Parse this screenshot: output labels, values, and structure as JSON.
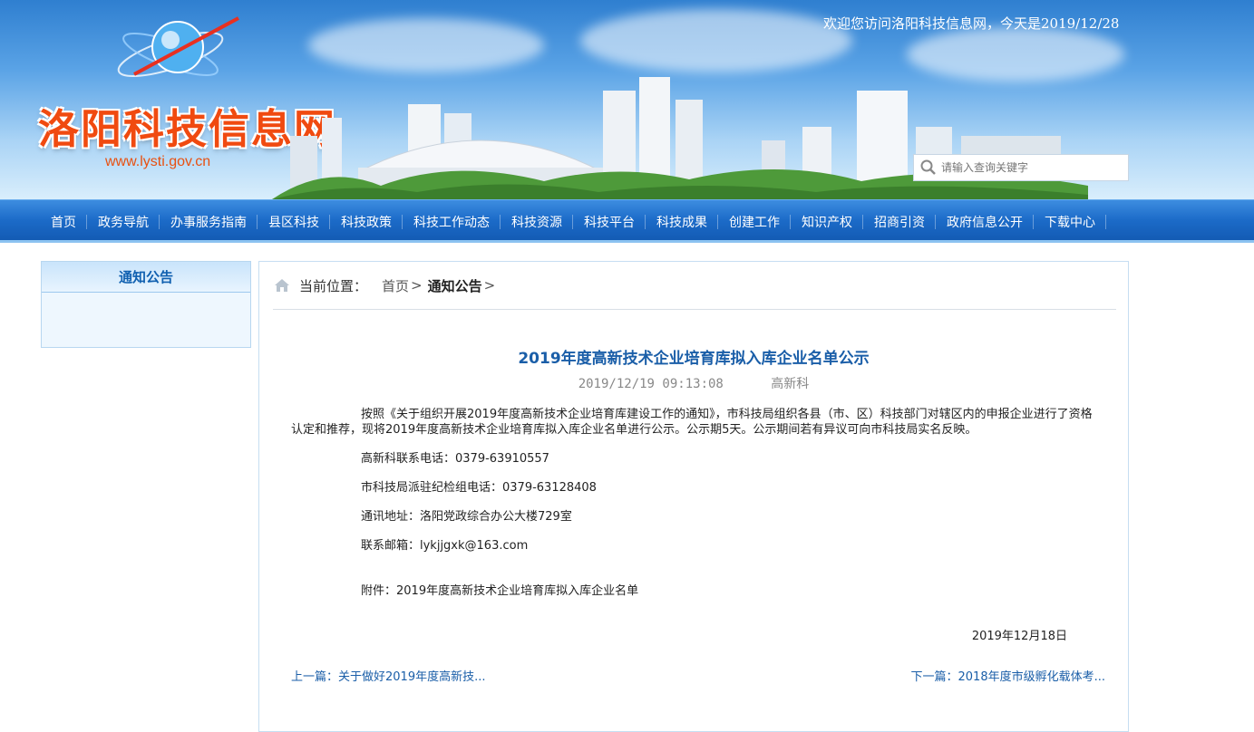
{
  "header": {
    "welcome_text": "欢迎您访问洛阳科技信息网，今天是2019/12/28",
    "site_name": "洛阳科技信息网",
    "site_url": "www.lysti.gov.cn",
    "search_placeholder": "请输入查询关键字"
  },
  "nav": {
    "items": [
      "首页",
      "政务导航",
      "办事服务指南",
      "县区科技",
      "科技政策",
      "科技工作动态",
      "科技资源",
      "科技平台",
      "科技成果",
      "创建工作",
      "知识产权",
      "招商引资",
      "政府信息公开",
      "下载中心"
    ]
  },
  "sidebar": {
    "title": "通知公告"
  },
  "breadcrumb": {
    "label": "当前位置：",
    "home": "首页",
    "current": "通知公告",
    "separator": ">"
  },
  "article": {
    "title": "2019年度高新技术企业培育库拟入库企业名单公示",
    "datetime": "2019/12/19 09:13:08",
    "department": "高新科",
    "paragraph": "按照《关于组织开展2019年度高新技术企业培育库建设工作的通知》，市科技局组织各县（市、区）科技部门对辖区内的申报企业进行了资格认定和推荐，现将2019年度高新技术企业培育库拟入库企业名单进行公示。公示期5天。公示期间若有异议可向市科技局实名反映。",
    "phone_hitech": "高新科联系电话：0379-63910557",
    "phone_discipline": "市科技局派驻纪检组电话：0379-63128408",
    "address": "通讯地址：洛阳党政综合办公大楼729室",
    "email": "联系邮箱：lykjjgxk@163.com",
    "attachment": "附件：2019年度高新技术企业培育库拟入库企业名单",
    "date": "2019年12月18日"
  },
  "pagination": {
    "prev": "上一篇：关于做好2019年度高新技...",
    "next": "下一篇：2018年度市级孵化载体考..."
  },
  "colors": {
    "nav_blue": "#1c6bc8",
    "title_blue": "#1a5ea8",
    "logo_orange": "#f04a10"
  }
}
